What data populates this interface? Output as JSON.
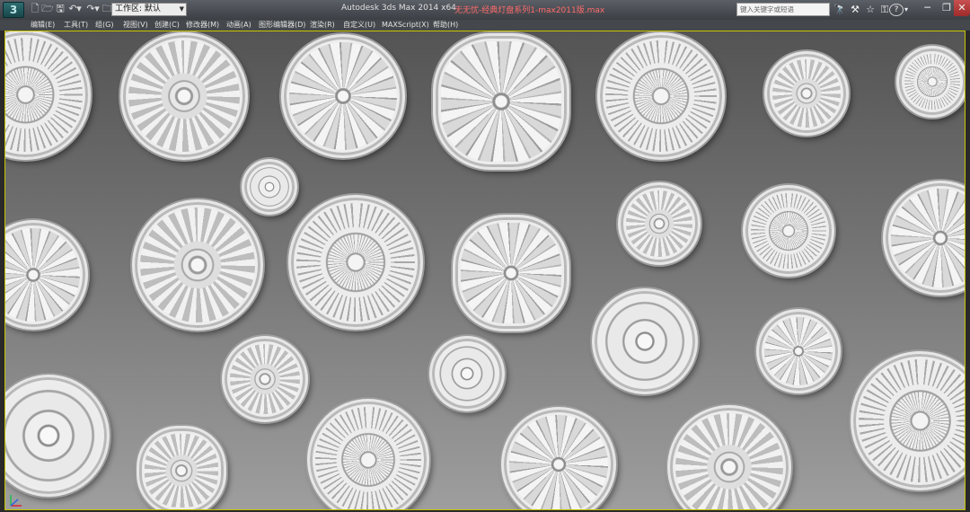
{
  "app": {
    "logo_letter": "3",
    "window_title": "Autodesk 3ds Max  2014 x64",
    "file_name": "无无忧-经典灯盘系列1-max2011版.max",
    "workspace": "工作区: 默认",
    "search_placeholder": "键入关键字或短语"
  },
  "quick_access": {
    "icons": [
      "new-file-icon",
      "open-folder-icon",
      "save-icon",
      "undo-icon",
      "dropdown-icon",
      "redo-icon",
      "dropdown-icon",
      "project-folder-icon"
    ],
    "glyphs": [
      "🗋",
      "🗁",
      "🖫",
      "↶",
      "▾",
      "↷",
      "▾",
      "🗀"
    ]
  },
  "title_tools": {
    "icons": [
      "binoculars-icon",
      "tools-icon",
      "star-icon",
      "key-icon",
      "help-icon",
      "help-dropdown-icon"
    ],
    "glyphs": [
      "🔭",
      "⚒",
      "☆",
      "⚿",
      "?",
      "▾"
    ]
  },
  "window_controls": {
    "minimize": "─",
    "restore": "❐",
    "close": "✕"
  },
  "menu": {
    "items": [
      "编辑(E)",
      "工具(T)",
      "组(G)",
      "视图(V)",
      "创建(C)",
      "修改器(M)",
      "动画(A)",
      "图形编辑器(D)",
      "渲染(R)",
      "自定义(U)",
      "MAXScript(X)",
      "帮助(H)"
    ]
  },
  "colors": {
    "viewport_border": "#c8c400",
    "file_name": "#ff6b6b",
    "title_bar": "#44474c"
  }
}
